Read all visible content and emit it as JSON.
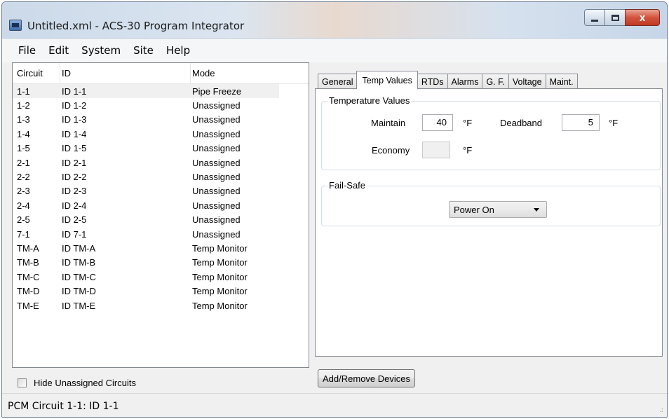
{
  "window": {
    "title": "Untitled.xml - ACS-30 Program Integrator",
    "close_glyph": "x"
  },
  "menu": [
    "File",
    "Edit",
    "System",
    "Site",
    "Help"
  ],
  "circuit_list": {
    "columns": [
      "Circuit",
      "ID",
      "Mode"
    ],
    "rows": [
      [
        "1-1",
        "ID 1-1",
        "Pipe Freeze"
      ],
      [
        "1-2",
        "ID 1-2",
        "Unassigned"
      ],
      [
        "1-3",
        "ID 1-3",
        "Unassigned"
      ],
      [
        "1-4",
        "ID 1-4",
        "Unassigned"
      ],
      [
        "1-5",
        "ID 1-5",
        "Unassigned"
      ],
      [
        "2-1",
        "ID 2-1",
        "Unassigned"
      ],
      [
        "2-2",
        "ID 2-2",
        "Unassigned"
      ],
      [
        "2-3",
        "ID 2-3",
        "Unassigned"
      ],
      [
        "2-4",
        "ID 2-4",
        "Unassigned"
      ],
      [
        "2-5",
        "ID 2-5",
        "Unassigned"
      ],
      [
        "7-1",
        "ID 7-1",
        "Unassigned"
      ],
      [
        "TM-A",
        "ID TM-A",
        "Temp Monitor"
      ],
      [
        "TM-B",
        "ID TM-B",
        "Temp Monitor"
      ],
      [
        "TM-C",
        "ID TM-C",
        "Temp Monitor"
      ],
      [
        "TM-D",
        "ID TM-D",
        "Temp Monitor"
      ],
      [
        "TM-E",
        "ID TM-E",
        "Temp Monitor"
      ]
    ]
  },
  "hide_unassigned": {
    "label": "Hide Unassigned Circuits",
    "checked": false
  },
  "status_text": "PCM Circuit 1-1: ID 1-1",
  "tabs": [
    "General",
    "Temp Values",
    "RTDs",
    "Alarms",
    "G. F.",
    "Voltage",
    "Maint."
  ],
  "active_tab": "Temp Values",
  "temperature_values": {
    "group_title": "Temperature Values",
    "maintain_label": "Maintain",
    "maintain_value": "40",
    "maintain_unit": "°F",
    "deadband_label": "Deadband",
    "deadband_value": "5",
    "deadband_unit": "°F",
    "economy_label": "Economy",
    "economy_value": "",
    "economy_unit": "°F"
  },
  "fail_safe": {
    "group_title": "Fail-Safe",
    "selected": "Power On"
  },
  "add_remove_button": "Add/Remove Devices"
}
